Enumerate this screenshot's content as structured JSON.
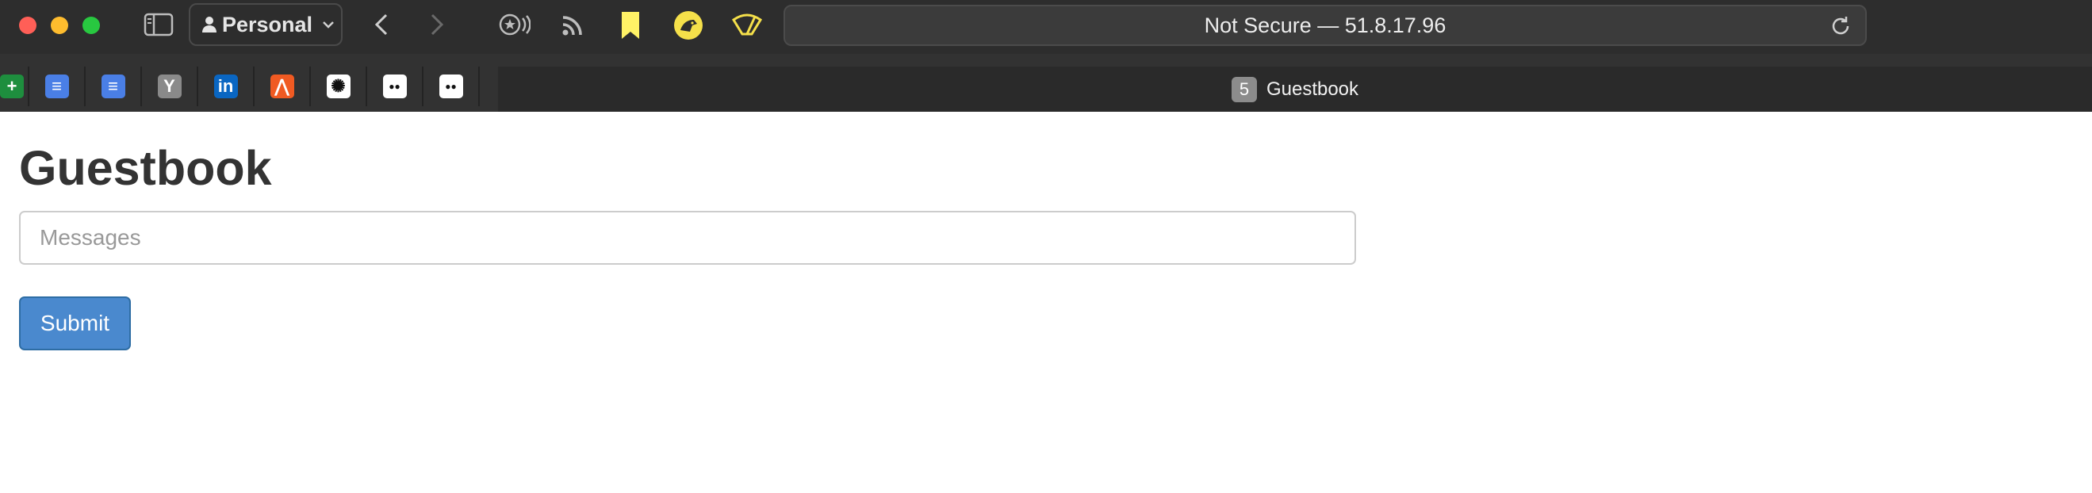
{
  "browser": {
    "profile": {
      "label": "Personal"
    },
    "address_bar": {
      "text": "Not Secure — 51.8.17.96"
    },
    "pinned_tabs": [
      {
        "icon": "google-sheets-icon",
        "glyph": "+",
        "color": "#1e8e3e"
      },
      {
        "icon": "google-docs-icon",
        "glyph": "≡",
        "color": "#4a7fe6"
      },
      {
        "icon": "google-docs-icon",
        "glyph": "≡",
        "color": "#4a7fe6"
      },
      {
        "icon": "y-site-icon",
        "glyph": "Y",
        "color": "#8a8a8a"
      },
      {
        "icon": "linkedin-icon",
        "glyph": "in",
        "color": "#0a66c2"
      },
      {
        "icon": "strava-icon",
        "glyph": "⋀",
        "color": "#f05a22"
      },
      {
        "icon": "openai-icon",
        "glyph": "✺",
        "color": "#ffffff"
      },
      {
        "icon": "medium-icon",
        "glyph": "●●",
        "color": "#ffffff"
      },
      {
        "icon": "medium-icon",
        "glyph": "●●",
        "color": "#ffffff"
      }
    ],
    "active_tab": {
      "count": "5",
      "title": "Guestbook"
    }
  },
  "page": {
    "title": "Guestbook",
    "message_input": {
      "placeholder": "Messages",
      "value": ""
    },
    "submit_label": "Submit"
  }
}
